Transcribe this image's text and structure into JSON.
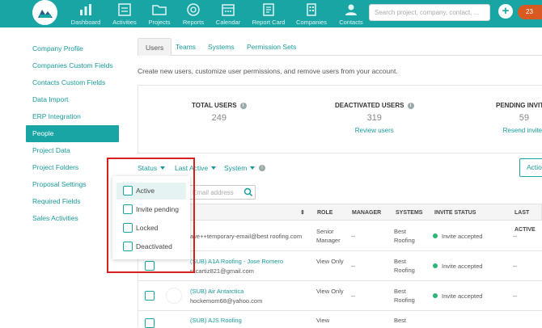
{
  "nav": {
    "search_placeholder": "Search project, company, contact, ...",
    "notification_count": "23",
    "items": [
      {
        "label": "Dashboard",
        "icon": "dashboard-icon"
      },
      {
        "label": "Activities",
        "icon": "activities-icon"
      },
      {
        "label": "Projects",
        "icon": "projects-icon"
      },
      {
        "label": "Reports",
        "icon": "reports-icon"
      },
      {
        "label": "Calendar",
        "icon": "calendar-icon"
      },
      {
        "label": "Report Card",
        "icon": "report-card-icon"
      },
      {
        "label": "Companies",
        "icon": "companies-icon"
      },
      {
        "label": "Contacts",
        "icon": "contacts-icon"
      }
    ]
  },
  "sidebar": {
    "items": [
      {
        "label": "Company Profile"
      },
      {
        "label": "Companies Custom Fields"
      },
      {
        "label": "Contacts Custom Fields"
      },
      {
        "label": "Data Import"
      },
      {
        "label": "ERP Integration"
      },
      {
        "label": "People"
      },
      {
        "label": "Project Data"
      },
      {
        "label": "Project Folders"
      },
      {
        "label": "Proposal Settings"
      },
      {
        "label": "Required Fields"
      },
      {
        "label": "Sales Activities"
      }
    ]
  },
  "tabs": [
    {
      "label": "Users"
    },
    {
      "label": "Teams"
    },
    {
      "label": "Systems"
    },
    {
      "label": "Permission Sets"
    }
  ],
  "description": "Create new users, customize user permissions, and remove users from your account.",
  "stats": {
    "total": {
      "label": "TOTAL USERS",
      "value": "249"
    },
    "deactivated": {
      "label": "DEACTIVATED USERS",
      "value": "319",
      "link": "Review users"
    },
    "pending": {
      "label": "PENDING INVITES",
      "value": "59",
      "link": "Resend invites"
    }
  },
  "filters": {
    "status": "Status",
    "last_active": "Last Active",
    "system": "System",
    "action_button": "Actions",
    "email_placeholder": "Email address"
  },
  "status_options": [
    {
      "label": "Active"
    },
    {
      "label": "Invite pending"
    },
    {
      "label": "Locked"
    },
    {
      "label": "Deactivated"
    }
  ],
  "table": {
    "headers": {
      "role": "ROLE",
      "manager": "MANAGER",
      "systems": "SYSTEMS",
      "invite_status": "INVITE STATUS",
      "last_active": "LAST ACTIVE"
    },
    "rows": [
      {
        "name": "",
        "email": "ave++temporary-email@best roofing.com",
        "role": "Senior Manager",
        "manager": "--",
        "systems": "Best Roofing",
        "invite": "Invite accepted",
        "last": "--"
      },
      {
        "name": "(SUB) A1A Roofing - Jose Romero",
        "email": "racartiz821@gmail.com",
        "role": "View Only",
        "manager": "--",
        "systems": "Best Roofing",
        "invite": "Invite accepted",
        "last": "--"
      },
      {
        "name": "(SUB) Air Antarctica",
        "email": "hockemom68@yahoo.com",
        "role": "View Only",
        "manager": "--",
        "systems": "Best Roofing",
        "invite": "Invite accepted",
        "last": "--"
      },
      {
        "name": "(SUB) AJS Roofing",
        "email": "",
        "role": "View",
        "manager": "",
        "systems": "Best",
        "invite": "",
        "last": ""
      }
    ]
  }
}
